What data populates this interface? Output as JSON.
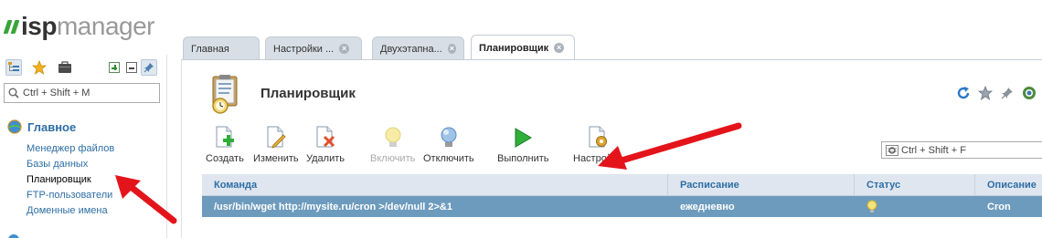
{
  "app": {
    "logo_isp": "isp",
    "logo_manager": "manager"
  },
  "sidebar": {
    "search_placeholder": "Ctrl + Shift + M",
    "group_label": "Главное",
    "items": [
      {
        "label": "Менеджер файлов",
        "active": false
      },
      {
        "label": "Базы данных",
        "active": false
      },
      {
        "label": "Планировщик",
        "active": true
      },
      {
        "label": "FTP-пользователи",
        "active": false
      },
      {
        "label": "Доменные имена",
        "active": false
      }
    ]
  },
  "tabs": [
    {
      "label": "Главная",
      "closable": false,
      "active": false
    },
    {
      "label": "Настройки ...",
      "closable": true,
      "active": false
    },
    {
      "label": "Двухэтапна...",
      "closable": true,
      "active": false
    },
    {
      "label": "Планировщик",
      "closable": true,
      "active": true
    }
  ],
  "page": {
    "title": "Планировщик",
    "filter_placeholder": "Ctrl + Shift + F"
  },
  "toolbar": {
    "create": "Создать",
    "edit": "Изменить",
    "delete": "Удалить",
    "enable": "Включить",
    "disable": "Отключить",
    "run": "Выполнить",
    "settings": "Настройки"
  },
  "table": {
    "columns": [
      "Команда",
      "Расписание",
      "Статус",
      "Описание"
    ],
    "rows": [
      {
        "command": "/usr/bin/wget http://mysite.ru/cron >/dev/null 2>&1",
        "schedule": "ежедневно",
        "status_icon": "lightbulb-on-icon",
        "description": "Cron",
        "selected": true
      }
    ]
  },
  "colors": {
    "accent": "#2e6ea4",
    "selected_row": "#6d9bbd",
    "header_bg": "#dfe6ef",
    "logo_green": "#3aa43a",
    "arrow_red": "#e4141b"
  }
}
